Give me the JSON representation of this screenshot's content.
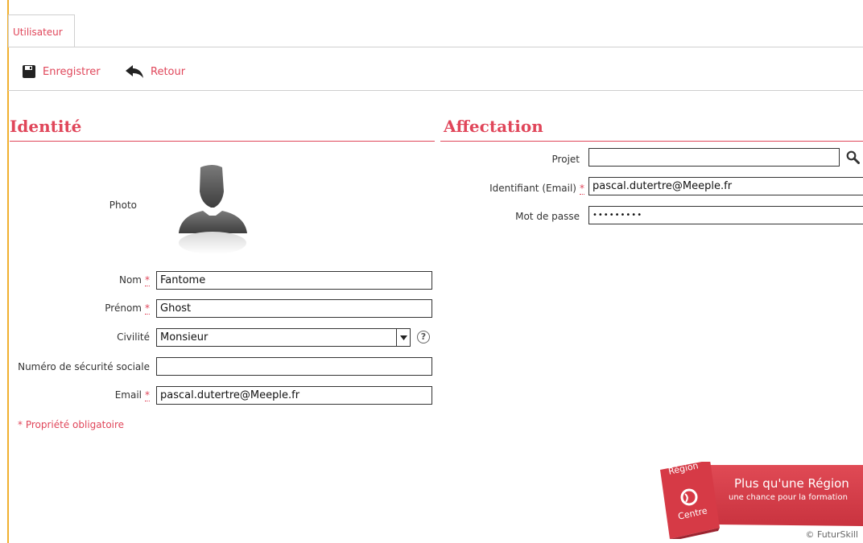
{
  "tab": {
    "label": "Utilisateur"
  },
  "toolbar": {
    "save_label": "Enregistrer",
    "back_label": "Retour"
  },
  "identity": {
    "title": "Identité",
    "photo_label": "Photo",
    "nom_label": "Nom",
    "nom_value": "Fantome",
    "prenom_label": "Prénom",
    "prenom_value": "Ghost",
    "civilite_label": "Civilité",
    "civilite_value": "Monsieur",
    "secu_label": "Numéro de sécurité sociale",
    "secu_value": "",
    "email_label": "Email",
    "email_value": "pascal.dutertre@Meeple.fr",
    "required_marker": "*",
    "required_note": "* Propriété obligatoire",
    "help_glyph": "?"
  },
  "affectation": {
    "title": "Affectation",
    "projet_label": "Projet",
    "projet_value": "",
    "identifiant_label": "Identifiant (Email)",
    "identifiant_value": "pascal.dutertre@Meeple.fr",
    "password_label": "Mot de passe",
    "password_value": "•••••••••"
  },
  "banner": {
    "region_line1": "Région",
    "region_line2": "Centre",
    "headline": "Plus qu'une Région",
    "tagline": "une chance pour la formation"
  },
  "footer": {
    "copyright": "© FuturSkill"
  },
  "colors": {
    "accent": "#e0465a",
    "left_bar": "#f0b030"
  }
}
